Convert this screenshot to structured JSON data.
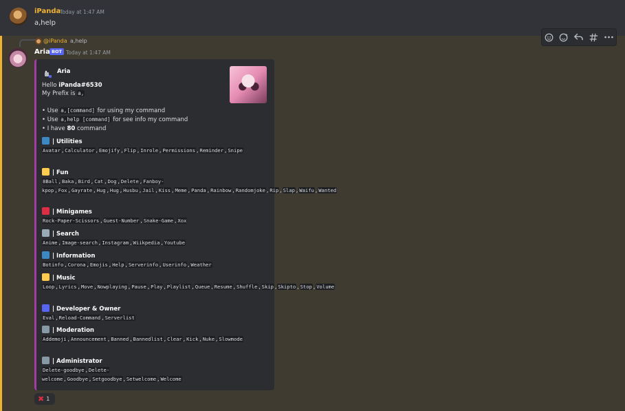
{
  "message1": {
    "author": "iPanda",
    "time": "Today at 1:47 AM",
    "text": "a,help"
  },
  "reply": {
    "mention": "@iPanda",
    "text": "a,help"
  },
  "message2": {
    "author": "Aria",
    "badge": "BOT",
    "time": "Today at 1:47 AM"
  },
  "toolbar": {
    "icons": [
      "add-reaction-icon",
      "super-reaction-icon",
      "reply-icon",
      "create-thread-icon",
      "more-icon"
    ]
  },
  "embed": {
    "author": "Aria",
    "hello": "Hello ",
    "user_tag": "iPanda#6530",
    "prefix_label": "My Prefix is ",
    "prefix": "a,",
    "bullet1_pre": "• Use ",
    "bullet1_code": "a,[command]",
    "bullet1_post": " for using my command",
    "bullet2_pre": "• Use ",
    "bullet2_code": "a,help [command]",
    "bullet2_post": " for see info my command",
    "bullet3_pre": "• I have ",
    "bullet3_count": "80",
    "bullet3_post": " command",
    "accent": "#a23ba6",
    "sections": [
      {
        "title": "| Utilities",
        "icon": "people-icon",
        "color": "#3b88c3",
        "cmds": [
          "Avatar",
          "Calculator",
          "Emojify",
          "Flip",
          "Inrole",
          "Permissions",
          "Reminder",
          "Snipe"
        ]
      },
      {
        "title": "| Fun",
        "icon": "grinning-face-icon",
        "color": "#ffcc4d",
        "cmds": [
          "8Ball",
          "Baka",
          "Bird",
          "Cat",
          "Dog",
          "Delete",
          "Fanboy-kpop",
          "Fox",
          "Gayrate",
          "Hug",
          "Hug",
          "Husbu",
          "Jail",
          "Kiss",
          "Meme",
          "Panda",
          "Rainbow",
          "Randomjoke",
          "Rip",
          "Slap",
          "Waifu",
          "Wanted"
        ]
      },
      {
        "title": "| Minigames",
        "icon": "dice-icon",
        "color": "#dd2e44",
        "cmds": [
          "Rock-Paper-Scissors",
          "Guest-Number",
          "Snake-Game",
          "Xox"
        ]
      },
      {
        "title": "| Search",
        "icon": "magnifier-icon",
        "color": "#9aaab4",
        "cmds": [
          "Anime",
          "Image-search",
          "Instagram",
          "Wiikpedia",
          "Youtube"
        ]
      },
      {
        "title": "| Information",
        "icon": "info-icon",
        "color": "#3b88c3",
        "cmds": [
          "Botinfo",
          "Corona",
          "Emojis",
          "Help",
          "Serverinfo",
          "Userinfo",
          "Weather"
        ]
      },
      {
        "title": "| Music",
        "icon": "music-note-icon",
        "color": "#ffcc4d",
        "cmds": [
          "Loop",
          "Lyrics",
          "Move",
          "Nowplaying",
          "Pause",
          "Play",
          "Playlist",
          "Queue",
          "Resume",
          "Shuffle",
          "Skip",
          "Skipto",
          "Stop",
          "Volume"
        ]
      },
      {
        "title": "| Developer & Owner",
        "icon": "globe-icon",
        "color": "#5865f2",
        "cmds": [
          "Eval",
          "Reload-Command",
          "Serverlist"
        ]
      },
      {
        "title": "| Moderation",
        "icon": "crossed-swords-icon",
        "color": "#8899a6",
        "cmds": [
          "Addemoji",
          "Announcement",
          "Banned",
          "Bannedlist",
          "Clear",
          "Kick",
          "Nuke",
          "Slowmode"
        ]
      },
      {
        "title": "| Administrator",
        "icon": "gear-icon",
        "color": "#8899a6",
        "cmds": [
          "Delete-goodbye",
          "Delete-welcome",
          "Goodbye",
          "Setgoodbye",
          "Setwelcome",
          "Welcome"
        ]
      }
    ]
  },
  "reaction": {
    "emoji": "✖",
    "count": "1"
  }
}
